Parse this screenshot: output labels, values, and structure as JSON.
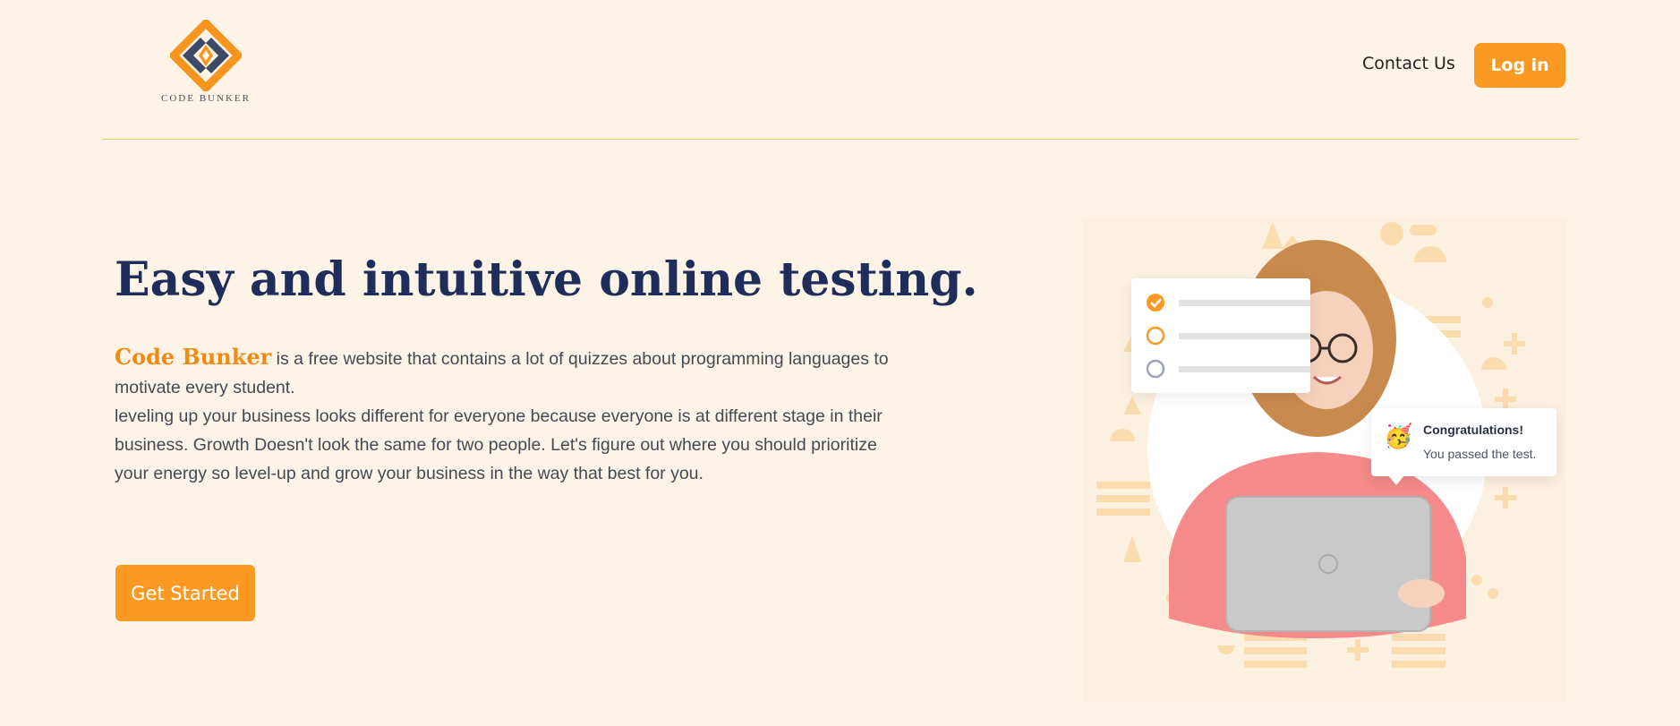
{
  "brand": {
    "logo_text": "CODE BUNKER",
    "logo_colors": {
      "dark": "#3d4a66",
      "orange": "#f7941d"
    }
  },
  "nav": {
    "contact_label": "Contact Us",
    "login_label": "Log in"
  },
  "hero": {
    "title": "Easy and intuitive online testing.",
    "brand_name": "Code Bunker",
    "intro": " is a free website that contains a lot of quizzes about programming languages to motivate every student.",
    "body": "leveling up your business looks different for everyone because everyone is at different stage in their business. Growth Doesn't look the same for two people. Let's figure out where you should prioritize your energy so level-up and grow your business in the way that best for you.",
    "cta_label": "Get Started"
  },
  "illustration": {
    "congrats_title": "Congratulations!",
    "congrats_subtitle": "You passed the test.",
    "congrats_emoji": "🥳",
    "accent": "#fb9a22"
  }
}
